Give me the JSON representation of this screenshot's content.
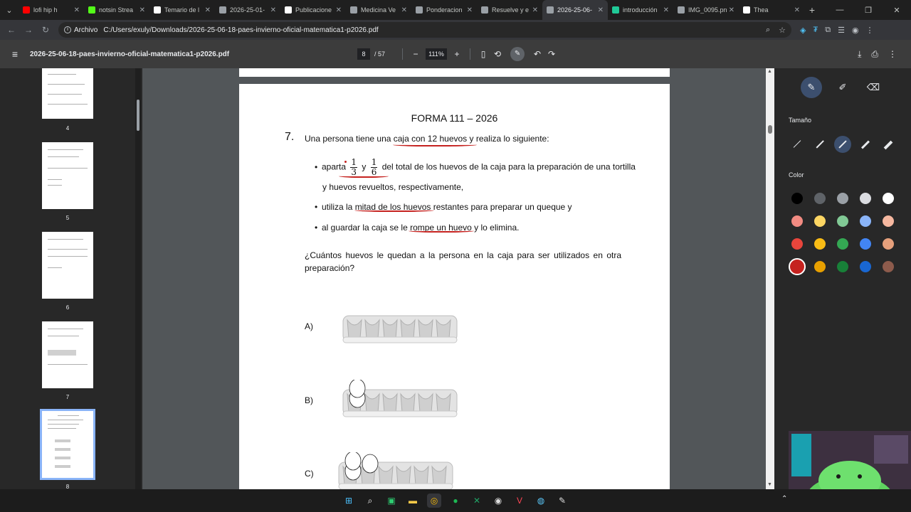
{
  "browser": {
    "tabs": [
      {
        "label": "lofi hip h",
        "color": "#ff0000",
        "icon": "youtube-icon"
      },
      {
        "label": "notsin Strea",
        "color": "#53fc18",
        "icon": "kick-icon"
      },
      {
        "label": "Temario de l",
        "color": "#ffffff",
        "icon": "doc-icon"
      },
      {
        "label": "2026-25-01-",
        "color": "#9aa0a6",
        "icon": "globe-icon"
      },
      {
        "label": "Publicacione",
        "color": "#ffffff",
        "icon": "doc-icon"
      },
      {
        "label": "Medicina Ve",
        "color": "#9aa0a6",
        "icon": "openai-icon"
      },
      {
        "label": "Ponderacion",
        "color": "#9aa0a6",
        "icon": "openai-icon"
      },
      {
        "label": "Resuelve y e",
        "color": "#9aa0a6",
        "icon": "openai-icon"
      },
      {
        "label": "2026-25-06-",
        "color": "#9aa0a6",
        "icon": "globe-icon",
        "active": true
      },
      {
        "label": "introducción",
        "color": "#20c997",
        "icon": "perplexity-icon"
      },
      {
        "label": "IMG_0095.pn",
        "color": "#9aa0a6",
        "icon": "image-icon"
      },
      {
        "label": "Thea",
        "color": "#ffffff",
        "icon": "feather-icon"
      }
    ],
    "address_chip": "Archivo",
    "url": "C:/Users/exuly/Downloads/2026-25-06-18-paes-invierno-oficial-matematica1-p2026.pdf"
  },
  "pdf": {
    "filename": "2026-25-06-18-paes-invierno-oficial-matematica1-p2026.pdf",
    "current_page": "8",
    "total_pages": "/ 57",
    "zoom": "111%"
  },
  "thumbnails": [
    {
      "num": "4"
    },
    {
      "num": "5"
    },
    {
      "num": "6"
    },
    {
      "num": "7"
    },
    {
      "num": "8"
    }
  ],
  "page": {
    "forma": "FORMA 111 –  2026",
    "qnum": "7.",
    "intro": "Una persona tiene una caja con 12 huevos y realiza lo siguiente:",
    "b1_pre": "aparta",
    "f1_num": "1",
    "f1_den": "3",
    "b1_y": "y",
    "f2_num": "1",
    "f2_den": "6",
    "b1_post": "del total de los huevos de la caja para la preparación de una tortilla",
    "b1_cont": "y huevos revueltos, respectivamente,",
    "b2": "utiliza la mitad de los huevos restantes para preparar un queque y",
    "b3": "al guardar la caja se le rompe un huevo y lo elimina.",
    "question": "¿Cuántos huevos le quedan a la persona en la caja para ser utilizados en otra preparación?",
    "options": [
      {
        "label": "A)",
        "eggs": 0
      },
      {
        "label": "B)",
        "eggs": 2
      },
      {
        "label": "C)",
        "eggs": 3
      }
    ]
  },
  "annotation": {
    "size_label": "Tamaño",
    "color_label": "Color",
    "colors": [
      [
        "#000000",
        "#5f6368",
        "#9aa0a6",
        "#dadce0",
        "#ffffff"
      ],
      [
        "#f28b82",
        "#fdd663",
        "#81c995",
        "#8ab4f8",
        "#f6b8a0"
      ],
      [
        "#e8453c",
        "#f9bc15",
        "#34a853",
        "#4285f4",
        "#e6a07c"
      ],
      [
        "#c5221f",
        "#e8a000",
        "#188038",
        "#1967d2",
        "#8d5b4c"
      ]
    ]
  }
}
